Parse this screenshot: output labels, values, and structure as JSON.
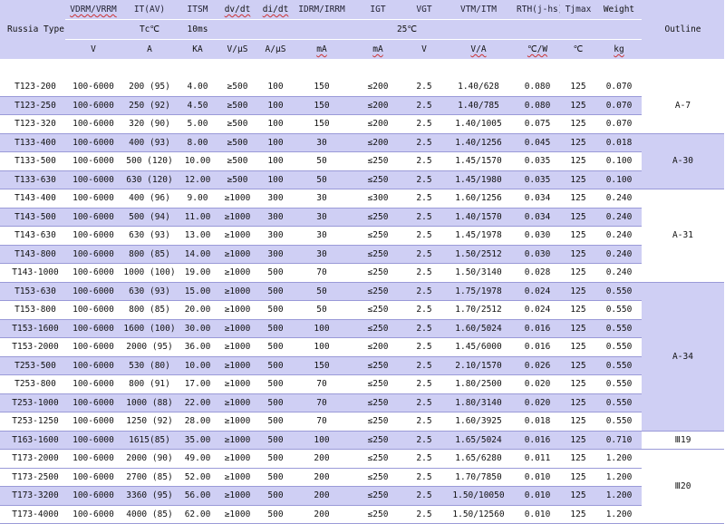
{
  "headers": {
    "row1": [
      "V<sub>DRM</sub>/V<sub>RRM</sub>",
      "I<sub>T(AV)</sub>",
      "I<sub>TSM</sub>",
      "dv/dt",
      "di/dt",
      "I<sub>DRM</sub>/I<sub>RRM</sub>",
      "I<sub>GT</sub>",
      "V<sub>GT</sub>",
      "V<sub>TM</sub>/I<sub>TM</sub>",
      "R<sub>TH(j-hs)</sub>",
      "T<sub>jmax</sub>",
      "Weight"
    ],
    "row1_text": [
      "VDRM/VRRM",
      "IT(AV)",
      "ITSM",
      "dv/dt",
      "di/dt",
      "IDRM/IRRM",
      "IGT",
      "VGT",
      "VTM/ITM",
      "RTH(j-hs)",
      "Tjmax",
      "Weight"
    ],
    "russia_type": "Russia Type",
    "outline": "Outline",
    "row2": {
      "tc": "Tc℃",
      "ms": "10ms",
      "temp": "25℃"
    },
    "units": [
      "V",
      "A",
      "KA",
      "V/μS",
      "A/μS",
      "mA",
      "mA",
      "V",
      "V/A",
      "℃/W",
      "℃",
      "kg"
    ]
  },
  "rows": [
    {
      "cells": [
        "T123-200",
        "100-6000",
        "200 (95)",
        "4.00",
        "≥500",
        "100",
        "150",
        "≤200",
        "2.5",
        "1.40/628",
        "0.080",
        "125",
        "0.070"
      ],
      "shade": false
    },
    {
      "cells": [
        "T123-250",
        "100-6000",
        "250 (92)",
        "4.50",
        "≥500",
        "100",
        "150",
        "≤200",
        "2.5",
        "1.40/785",
        "0.080",
        "125",
        "0.070"
      ],
      "shade": true
    },
    {
      "cells": [
        "T123-320",
        "100-6000",
        "320 (90)",
        "5.00",
        "≥500",
        "100",
        "150",
        "≤200",
        "2.5",
        "1.40/1005",
        "0.075",
        "125",
        "0.070"
      ],
      "shade": false
    },
    {
      "cells": [
        "T133-400",
        "100-6000",
        "400 (93)",
        "8.00",
        "≥500",
        "100",
        "30",
        "≤200",
        "2.5",
        "1.40/1256",
        "0.045",
        "125",
        "0.018"
      ],
      "shade": true
    },
    {
      "cells": [
        "T133-500",
        "100-6000",
        "500 (120)",
        "10.00",
        "≥500",
        "100",
        "50",
        "≤250",
        "2.5",
        "1.45/1570",
        "0.035",
        "125",
        "0.100"
      ],
      "shade": false
    },
    {
      "cells": [
        "T133-630",
        "100-6000",
        "630 (120)",
        "12.00",
        "≥500",
        "100",
        "50",
        "≤250",
        "2.5",
        "1.45/1980",
        "0.035",
        "125",
        "0.100"
      ],
      "shade": true
    },
    {
      "cells": [
        "T143-400",
        "100-6000",
        "400 (96)",
        "9.00",
        "≥1000",
        "300",
        "30",
        "≤300",
        "2.5",
        "1.60/1256",
        "0.034",
        "125",
        "0.240"
      ],
      "shade": false
    },
    {
      "cells": [
        "T143-500",
        "100-6000",
        "500 (94)",
        "11.00",
        "≥1000",
        "300",
        "30",
        "≤250",
        "2.5",
        "1.40/1570",
        "0.034",
        "125",
        "0.240"
      ],
      "shade": true
    },
    {
      "cells": [
        "T143-630",
        "100-6000",
        "630 (93)",
        "13.00",
        "≥1000",
        "300",
        "30",
        "≤250",
        "2.5",
        "1.45/1978",
        "0.030",
        "125",
        "0.240"
      ],
      "shade": false
    },
    {
      "cells": [
        "T143-800",
        "100-6000",
        "800 (85)",
        "14.00",
        "≥1000",
        "300",
        "30",
        "≤250",
        "2.5",
        "1.50/2512",
        "0.030",
        "125",
        "0.240"
      ],
      "shade": true
    },
    {
      "cells": [
        "T143-1000",
        "100-6000",
        "1000 (100)",
        "19.00",
        "≥1000",
        "500",
        "70",
        "≤250",
        "2.5",
        "1.50/3140",
        "0.028",
        "125",
        "0.240"
      ],
      "shade": false
    },
    {
      "cells": [
        "T153-630",
        "100-6000",
        "630 (93)",
        "15.00",
        "≥1000",
        "500",
        "50",
        "≤250",
        "2.5",
        "1.75/1978",
        "0.024",
        "125",
        "0.550"
      ],
      "shade": true
    },
    {
      "cells": [
        "T153-800",
        "100-6000",
        "800 (85)",
        "20.00",
        "≥1000",
        "500",
        "50",
        "≤250",
        "2.5",
        "1.70/2512",
        "0.024",
        "125",
        "0.550"
      ],
      "shade": false
    },
    {
      "cells": [
        "T153-1600",
        "100-6000",
        "1600 (100)",
        "30.00",
        "≥1000",
        "500",
        "100",
        "≤250",
        "2.5",
        "1.60/5024",
        "0.016",
        "125",
        "0.550"
      ],
      "shade": true
    },
    {
      "cells": [
        "T153-2000",
        "100-6000",
        "2000 (95)",
        "36.00",
        "≥1000",
        "500",
        "100",
        "≤200",
        "2.5",
        "1.45/6000",
        "0.016",
        "125",
        "0.550"
      ],
      "shade": false
    },
    {
      "cells": [
        "T253-500",
        "100-6000",
        "530 (80)",
        "10.00",
        "≥1000",
        "500",
        "150",
        "≤250",
        "2.5",
        "2.10/1570",
        "0.026",
        "125",
        "0.550"
      ],
      "shade": true
    },
    {
      "cells": [
        "T253-800",
        "100-6000",
        "800 (91)",
        "17.00",
        "≥1000",
        "500",
        "70",
        "≤250",
        "2.5",
        "1.80/2500",
        "0.020",
        "125",
        "0.550"
      ],
      "shade": false
    },
    {
      "cells": [
        "T253-1000",
        "100-6000",
        "1000 (88)",
        "22.00",
        "≥1000",
        "500",
        "70",
        "≤250",
        "2.5",
        "1.80/3140",
        "0.020",
        "125",
        "0.550"
      ],
      "shade": true
    },
    {
      "cells": [
        "T253-1250",
        "100-6000",
        "1250 (92)",
        "28.00",
        "≥1000",
        "500",
        "70",
        "≤250",
        "2.5",
        "1.60/3925",
        "0.018",
        "125",
        "0.550"
      ],
      "shade": false
    },
    {
      "cells": [
        "T163-1600",
        "100-6000",
        "1615(85)",
        "35.00",
        "≥1000",
        "500",
        "100",
        "≤250",
        "2.5",
        "1.65/5024",
        "0.016",
        "125",
        "0.710"
      ],
      "shade": true
    },
    {
      "cells": [
        "T173-2000",
        "100-6000",
        "2000 (90)",
        "49.00",
        "≥1000",
        "500",
        "200",
        "≤250",
        "2.5",
        "1.65/6280",
        "0.011",
        "125",
        "1.200"
      ],
      "shade": false
    },
    {
      "cells": [
        "T173-2500",
        "100-6000",
        "2700 (85)",
        "52.00",
        "≥1000",
        "500",
        "200",
        "≤250",
        "2.5",
        "1.70/7850",
        "0.010",
        "125",
        "1.200"
      ],
      "shade": false
    },
    {
      "cells": [
        "T173-3200",
        "100-6000",
        "3360 (95)",
        "56.00",
        "≥1000",
        "500",
        "200",
        "≤250",
        "2.5",
        "1.50/10050",
        "0.010",
        "125",
        "1.200"
      ],
      "shade": true
    },
    {
      "cells": [
        "T173-4000",
        "100-6000",
        "4000 (85)",
        "62.00",
        "≥1000",
        "500",
        "200",
        "≤250",
        "2.5",
        "1.50/12560",
        "0.010",
        "125",
        "1.200"
      ],
      "shade": false
    }
  ],
  "outline_groups": [
    {
      "label": "A-7",
      "start": 0,
      "span": 3,
      "shade": false
    },
    {
      "label": "A-30",
      "start": 3,
      "span": 3,
      "shade": true
    },
    {
      "label": "A-31",
      "start": 6,
      "span": 5,
      "shade": false
    },
    {
      "label": "A-34",
      "start": 11,
      "span": 8,
      "shade": true
    },
    {
      "label": "Ⅲ19",
      "start": 19,
      "span": 1,
      "shade": false
    },
    {
      "label": "Ⅲ20",
      "start": 20,
      "span": 4,
      "shade": false
    }
  ],
  "colors": {
    "band": "#cfcff4",
    "line": "#9a9ad8",
    "text": "#111111"
  }
}
